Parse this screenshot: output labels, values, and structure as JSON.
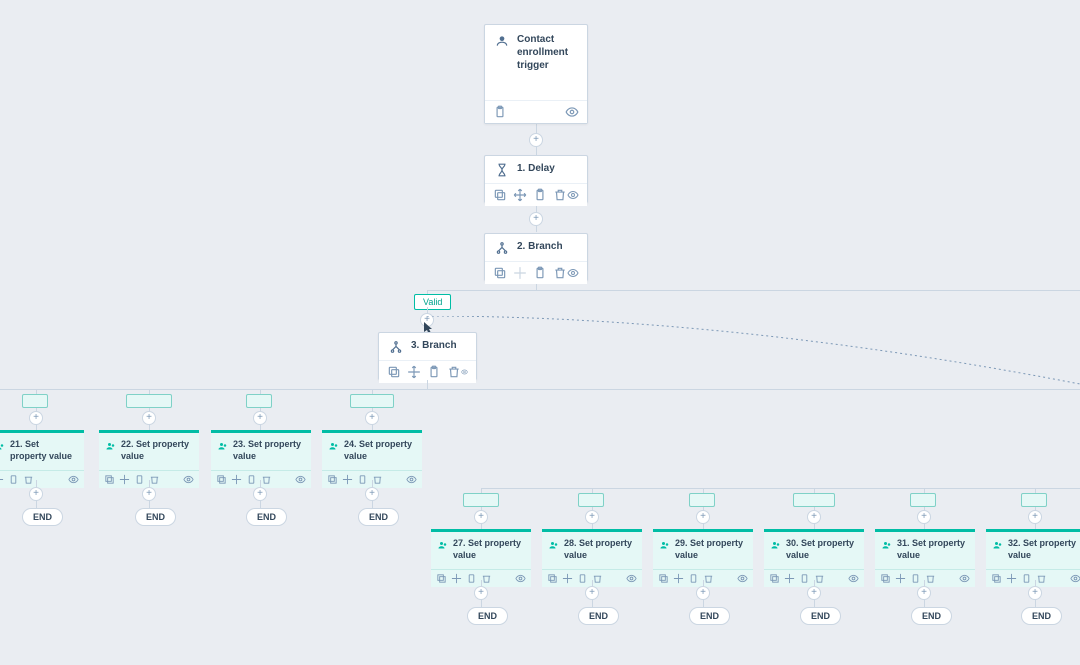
{
  "trigger": {
    "title": "Contact enrollment trigger"
  },
  "step1": {
    "title": "1. Delay"
  },
  "step2": {
    "title": "2. Branch"
  },
  "step3": {
    "title": "3. Branch"
  },
  "branchLabel": {
    "valid": "Valid"
  },
  "end": "END",
  "props": {
    "p21": "21. Set property value",
    "p22": "22. Set property value",
    "p23": "23. Set property value",
    "p24": "24. Set property value",
    "p27": "27. Set property value",
    "p28": "28. Set property value",
    "p29": "29. Set property value",
    "p30": "30. Set property value",
    "p31": "31. Set property value",
    "p32": "32. Set property value"
  }
}
